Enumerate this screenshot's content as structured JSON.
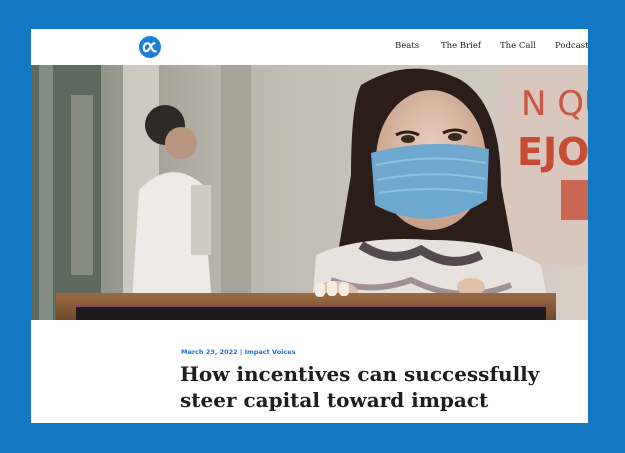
{
  "header": {
    "logo_icon": "alpha-logo-icon",
    "nav": [
      "Beats",
      "The Brief",
      "The Call",
      "Podcasts"
    ]
  },
  "hero": {
    "image_subject": "woman-wearing-face-mask-holding-frame"
  },
  "article": {
    "date": "March 23, 2022",
    "separator": " | ",
    "category": "Impact Voices",
    "title": "How incentives can successfully steer capital toward impact"
  },
  "colors": {
    "frame_blue": "#1479c4",
    "logo_blue": "#1b7fd8",
    "link_blue": "#1a73d9"
  }
}
